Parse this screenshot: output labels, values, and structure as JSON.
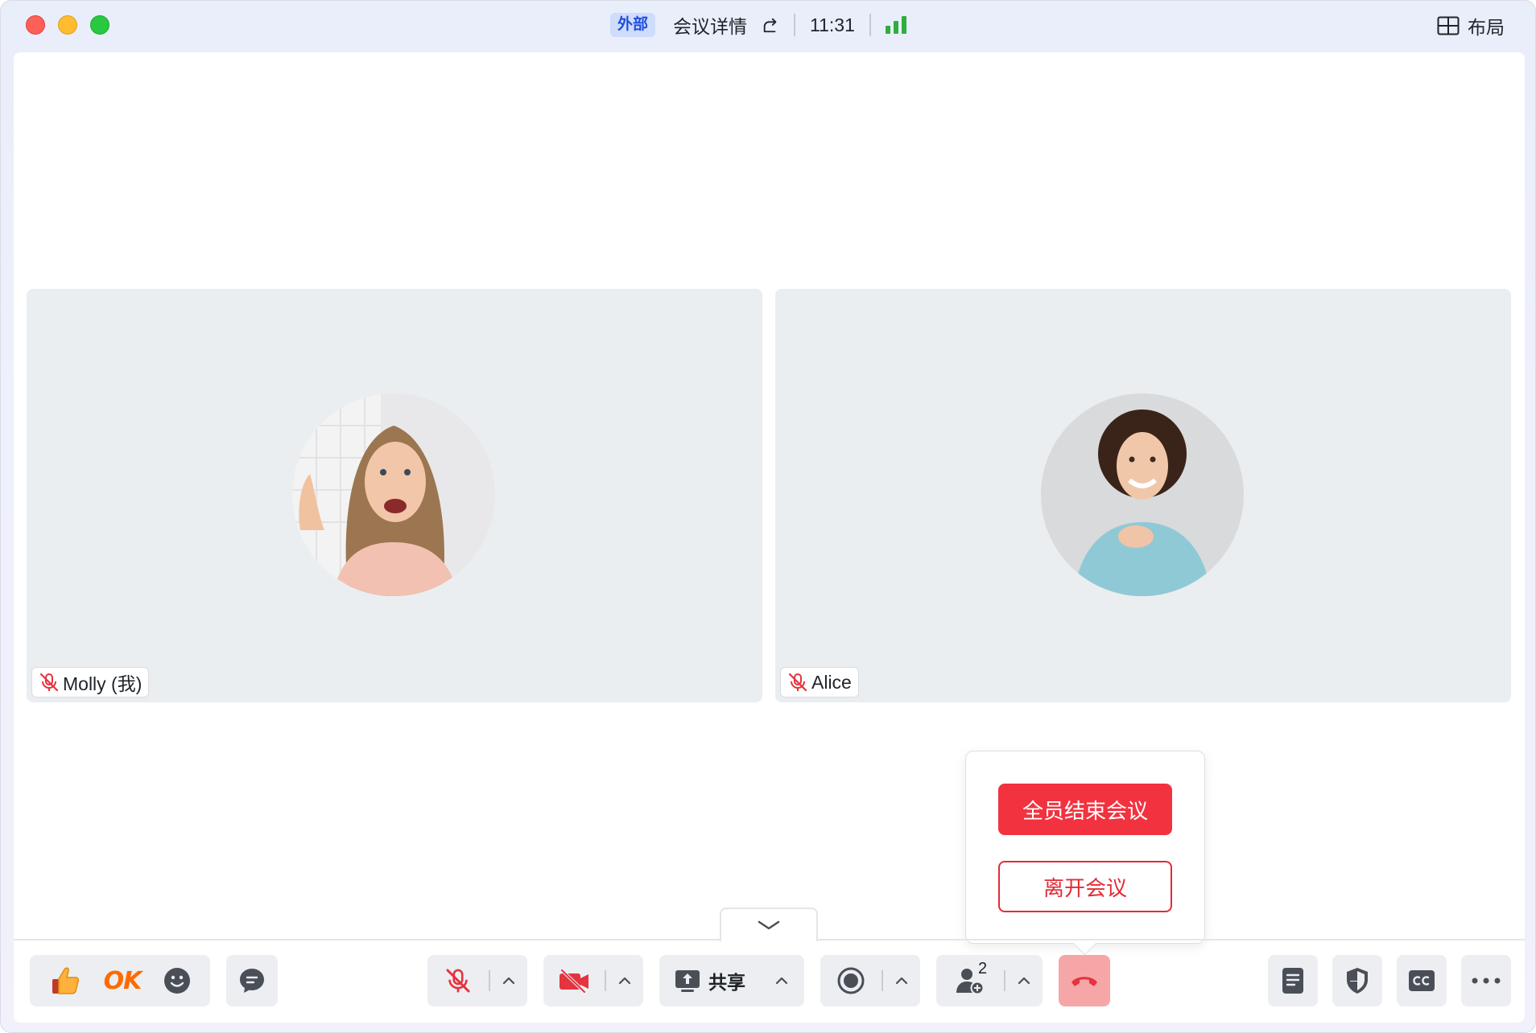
{
  "titlebar": {
    "badge": "外部",
    "meeting_details": "会议详情",
    "time": "11:31",
    "layout_label": "布局"
  },
  "participants": [
    {
      "name": "Molly (我)",
      "muted": true
    },
    {
      "name": "Alice",
      "muted": true
    }
  ],
  "end_popup": {
    "end_for_all": "全员结束会议",
    "leave": "离开会议"
  },
  "toolbar": {
    "reaction_ok": "OK",
    "share_label": "共享",
    "participant_count": "2"
  },
  "colors": {
    "accent_red": "#f2323f",
    "hangup_bg": "#f7a6a8",
    "signal_green": "#2eae3e",
    "badge_blue": "#1f4fe0"
  }
}
